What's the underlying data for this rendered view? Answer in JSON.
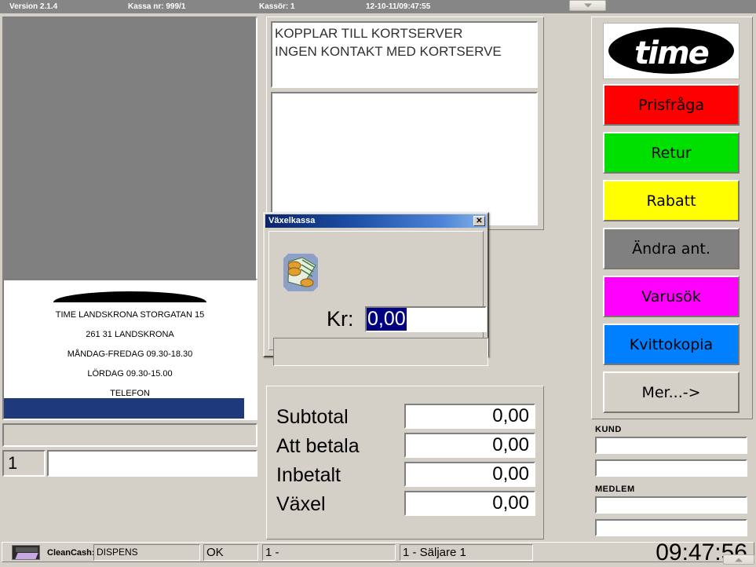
{
  "topbar": {
    "version": "Version 2.1.4",
    "register": "Kassa nr: 999/1",
    "cashier": "Kassör: 1",
    "datetime": "12-10-11/09:47:55",
    "minimize_icon": "chevron-down-icon",
    "maximize_icon": "chevron-up-icon"
  },
  "messages": {
    "line1": "KOPPLAR TILL KORTSERVER",
    "line2": "INGEN KONTAKT MED KORTSERVE"
  },
  "receipt": {
    "lines": [
      "TIME LANDSKRONA STORGATAN 15",
      "261 31 LANDSKRONA",
      "MÅNDAG-FREDAG 09.30-18.30",
      "LÖRDAG  09.30-15.00",
      "TELEFON"
    ]
  },
  "entry": {
    "quantity": "1",
    "scan_value": "",
    "scan_placeholder": ""
  },
  "totals": [
    {
      "label": "Subtotal",
      "value": "0,00"
    },
    {
      "label": "Att betala",
      "value": "0,00"
    },
    {
      "label": "Inbetalt",
      "value": "0,00"
    },
    {
      "label": "Växel",
      "value": "0,00"
    }
  ],
  "sidebar": {
    "logo_text": "time",
    "buttons": [
      {
        "label": "Prisfråga",
        "color": "#ff0000"
      },
      {
        "label": "Retur",
        "color": "#00e000"
      },
      {
        "label": "Rabatt",
        "color": "#ffff00"
      },
      {
        "label": "Ändra ant.",
        "color": "#808080"
      },
      {
        "label": "Varusök",
        "color": "#ff00ff"
      },
      {
        "label": "Kvittokopia",
        "color": "#0080ff"
      },
      {
        "label": "Mer...->",
        "color": "#d4d0c8"
      }
    ],
    "kund_label": "KUND",
    "kund_field1": "",
    "kund_field2": "",
    "medlem_label": "MEDLEM",
    "medlem_field1": "",
    "medlem_field2": ""
  },
  "dialog": {
    "title": "Växelkassa",
    "close_icon": "close-icon",
    "cash_icon": "cash-money-icon",
    "currency_label": "Kr:",
    "amount_value": "0,00"
  },
  "statusbar": {
    "device_icon": "cleancash-device-icon",
    "device_label": "CleanCash:",
    "device_status": "DISPENS",
    "ok_status": "OK",
    "register_num": "1 -",
    "seller": "1 - Säljare 1",
    "clock": "09:47:56"
  }
}
